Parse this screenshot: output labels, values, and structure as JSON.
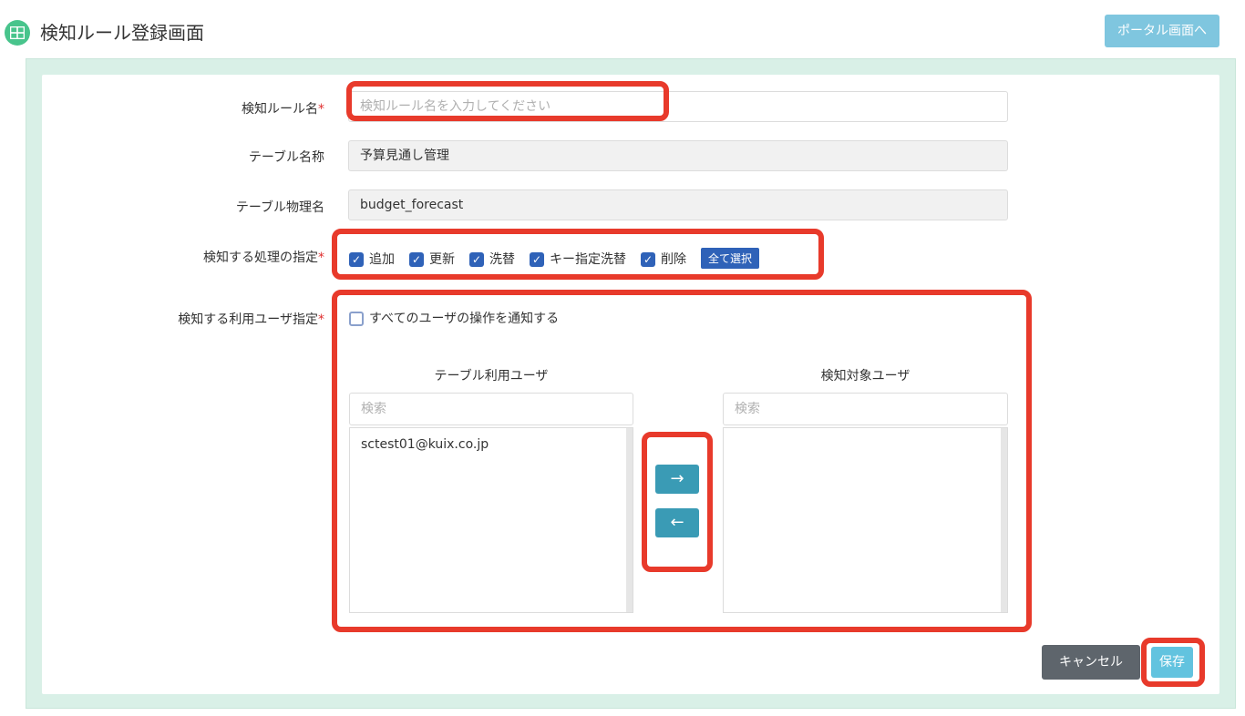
{
  "header": {
    "title": "検知ルール登録画面",
    "portal_button": "ポータル画面へ"
  },
  "form": {
    "rule_name": {
      "label": "検知ルール名",
      "required_mark": "*",
      "placeholder": "検知ルール名を入力してください"
    },
    "table_name": {
      "label": "テーブル名称",
      "value": "予算見通し管理"
    },
    "table_physical": {
      "label": "テーブル物理名",
      "value": "budget_forecast"
    },
    "operations": {
      "label": "検知する処理の指定",
      "required_mark": "*",
      "items": [
        {
          "label": "追加",
          "checked": true
        },
        {
          "label": "更新",
          "checked": true
        },
        {
          "label": "洗替",
          "checked": true
        },
        {
          "label": "キー指定洗替",
          "checked": true
        },
        {
          "label": "削除",
          "checked": true
        }
      ],
      "select_all": "全て選択"
    },
    "users": {
      "label": "検知する利用ユーザ指定",
      "required_mark": "*",
      "notify_all": {
        "label": "すべてのユーザの操作を通知する",
        "checked": false
      },
      "left": {
        "header": "テーブル利用ユーザ",
        "search_placeholder": "検索",
        "items": [
          "sctest01@kuix.co.jp"
        ]
      },
      "right": {
        "header": "検知対象ユーザ",
        "search_placeholder": "検索",
        "items": []
      },
      "move_right": "→",
      "move_left": "←"
    }
  },
  "footer": {
    "cancel": "キャンセル",
    "save": "保存"
  },
  "colors": {
    "accent": "#2f62b8",
    "highlight": "#e83a2b",
    "teal": "#3a9bb5"
  }
}
